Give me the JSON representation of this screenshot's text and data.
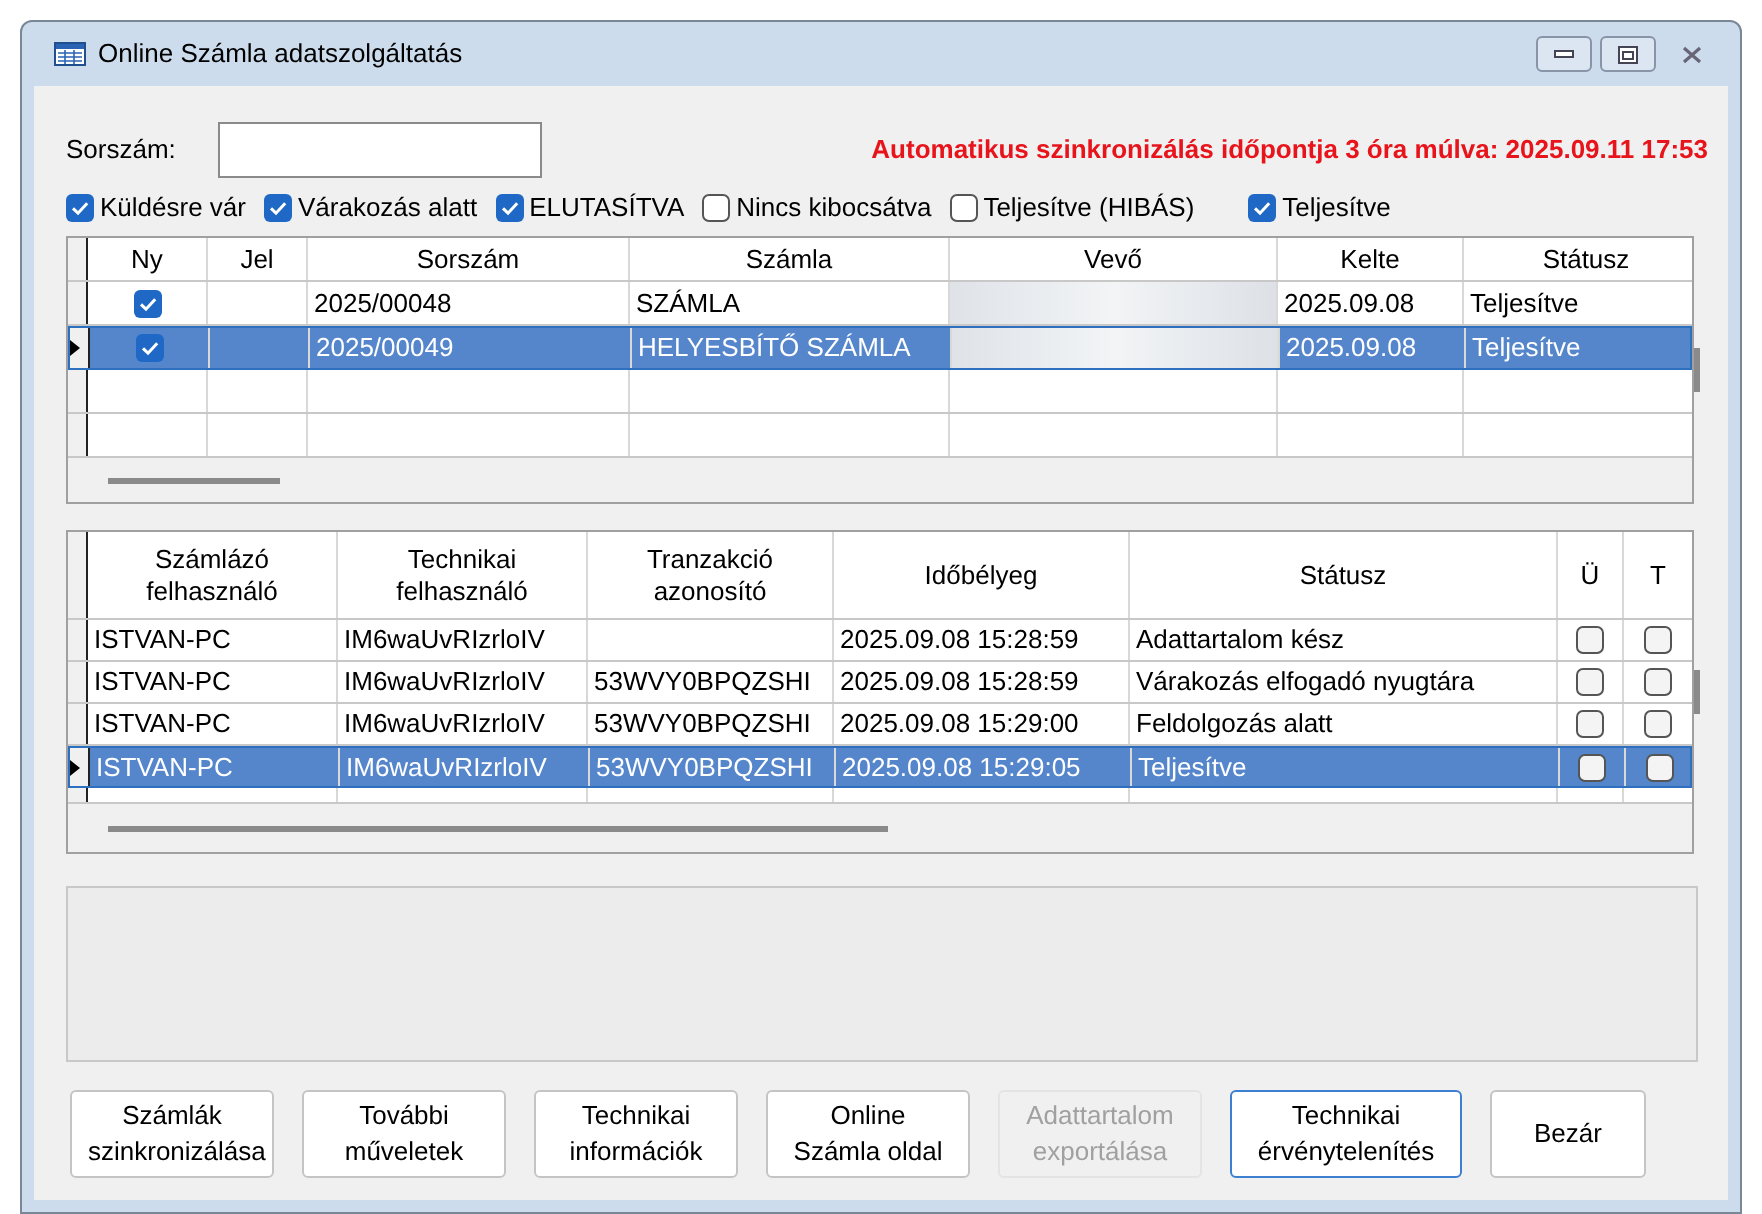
{
  "window": {
    "title": "Online Számla adatszolgáltatás"
  },
  "search": {
    "label": "Sorszám:"
  },
  "sync_notice": "Automatikus szinkronizálás időpontja 3 óra múlva: 2025.09.11 17:53",
  "filters": [
    {
      "label": "Küldésre vár",
      "checked": true
    },
    {
      "label": "Várakozás alatt",
      "checked": true
    },
    {
      "label": "ELUTASÍTVA",
      "checked": true
    },
    {
      "label": "Nincs kibocsátva",
      "checked": false
    },
    {
      "label": "Teljesítve (HIBÁS)",
      "checked": false
    },
    {
      "label": "Teljesítve",
      "checked": true
    }
  ],
  "invoice_table": {
    "columns": [
      "Ny",
      "Jel",
      "Sorszám",
      "Számla",
      "Vevő",
      "Kelte",
      "Státusz"
    ],
    "rows": [
      {
        "checked": true,
        "sorszam": "2025/00048",
        "szamla": "SZÁMLA",
        "kelte": "2025.09.08",
        "statusz": "Teljesítve",
        "selected": false
      },
      {
        "checked": true,
        "sorszam": "2025/00049",
        "szamla": "HELYESBÍTŐ SZÁMLA",
        "kelte": "2025.09.08",
        "statusz": "Teljesítve",
        "selected": true
      }
    ]
  },
  "transaction_table": {
    "columns": [
      "Számlázó felhasználó",
      "Technikai felhasználó",
      "Tranzakció azonosító",
      "Időbélyeg",
      "Státusz",
      "Ü",
      "T"
    ],
    "rows": [
      {
        "szamlazo": "ISTVAN-PC",
        "technikai": "IM6waUvRIzrloIV",
        "idobelyeg": "2025.09.08 15:28:59",
        "statusz": "Adattartalom kész",
        "u": false,
        "t": false,
        "selected": false
      },
      {
        "szamlazo": "ISTVAN-PC",
        "technikai": "IM6waUvRIzrloIV",
        "tranzakcio": "53WVY0BPQZSHI",
        "idobelyeg": "2025.09.08 15:28:59",
        "statusz": "Várakozás elfogadó nyugtára",
        "u": false,
        "t": false,
        "selected": false
      },
      {
        "szamlazo": "ISTVAN-PC",
        "technikai": "IM6waUvRIzrloIV",
        "tranzakcio": "53WVY0BPQZSHI",
        "idobelyeg": "2025.09.08 15:29:00",
        "statusz": "Feldolgozás alatt",
        "u": false,
        "t": false,
        "selected": false
      },
      {
        "szamlazo": "ISTVAN-PC",
        "technikai": "IM6waUvRIzrloIV",
        "tranzakcio": "53WVY0BPQZSHI",
        "idobelyeg": "2025.09.08 15:29:05",
        "statusz": "Teljesítve",
        "u": false,
        "t": false,
        "selected": true
      }
    ]
  },
  "buttons": [
    {
      "label": "Számlák\nszinkronizálása",
      "disabled": false,
      "focused": false
    },
    {
      "label": "További\nműveletek",
      "disabled": false,
      "focused": false
    },
    {
      "label": "Technikai\ninformációk",
      "disabled": false,
      "focused": false
    },
    {
      "label": "Online\nSzámla oldal",
      "disabled": false,
      "focused": false
    },
    {
      "label": "Adattartalom\nexportálása",
      "disabled": true,
      "focused": false
    },
    {
      "label": "Technikai\nérvénytelenítés",
      "disabled": false,
      "focused": true
    },
    {
      "label": "Bezár",
      "disabled": false,
      "focused": false
    }
  ]
}
